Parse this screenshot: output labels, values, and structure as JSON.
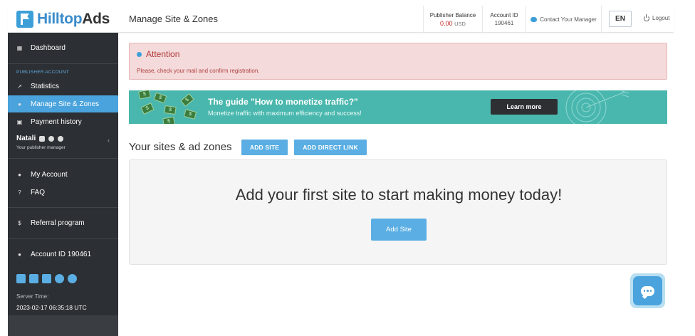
{
  "brand": {
    "name_part1": "Hilltop",
    "name_part2": "Ads"
  },
  "header": {
    "title": "Manage Site & Zones",
    "balance_label": "Publisher Balance",
    "balance_value": "0.00",
    "balance_currency": "USD",
    "account_label": "Account ID",
    "account_value": "190461",
    "contact_manager": "Contact Your Manager",
    "language": "EN",
    "logout": "Logout"
  },
  "sidebar": {
    "dashboard": "Dashboard",
    "section_label": "PUBLISHER ACCOUNT",
    "statistics": "Statistics",
    "manage": "Manage Site & Zones",
    "payment_history": "Payment history",
    "manager_name": "Natali",
    "manager_sub": "Your publisher manager",
    "my_account": "My Account",
    "faq": "FAQ",
    "referral": "Referral program",
    "account_id": "Account ID 190461",
    "server_time_label": "Server Time:",
    "server_time_value": "2023-02-17 06:35:18 UTC"
  },
  "alert": {
    "title": "Attention",
    "message": "Please, check your mail and confirm registration."
  },
  "banner": {
    "title": "The guide \"How to monetize traffic?\"",
    "subtitle": "Monetize traffic with maximum efficiency and success!",
    "button": "Learn more"
  },
  "sites": {
    "title": "Your sites & ad zones",
    "add_site_button": "ADD SITE",
    "add_direct_link_button": "ADD DIRECT LINK",
    "empty_message": "Add your first site to start making money today!",
    "add_site_cta": "Add Site"
  },
  "colors": {
    "accent": "#4aa3dc",
    "sidebar_bg": "#2c2f33",
    "banner_bg": "#4ab7ae",
    "alert_bg": "#f4dada",
    "alert_text": "#b03a3a"
  }
}
